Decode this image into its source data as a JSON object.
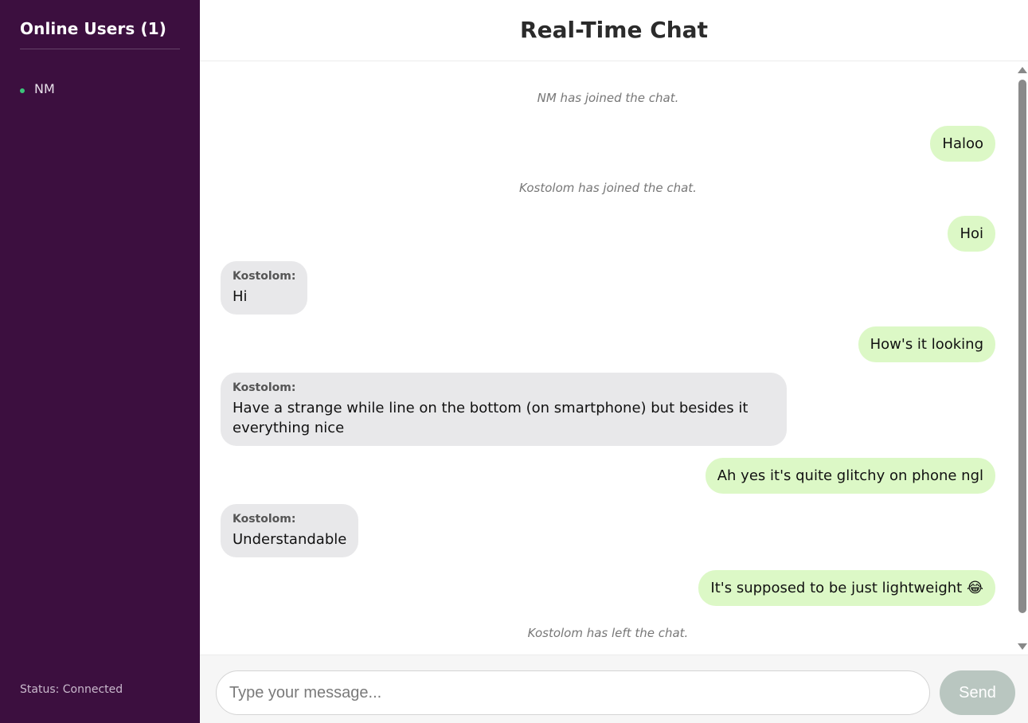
{
  "sidebar": {
    "title": "Online Users (1)",
    "users": [
      {
        "name": "NM"
      }
    ],
    "status": "Status: Connected"
  },
  "header": {
    "title": "Real-Time Chat"
  },
  "messages": [
    {
      "type": "system",
      "text": "NM has joined the chat."
    },
    {
      "type": "sent",
      "text": "Haloo"
    },
    {
      "type": "system",
      "text": "Kostolom has joined the chat."
    },
    {
      "type": "sent",
      "text": "Hoi"
    },
    {
      "type": "received",
      "sender": "Kostolom:",
      "text": "Hi"
    },
    {
      "type": "sent",
      "text": "How's it looking"
    },
    {
      "type": "received",
      "sender": "Kostolom:",
      "text": "Have a strange while line on the bottom (on smartphone) but besides it everything nice"
    },
    {
      "type": "sent",
      "text": "Ah yes it's quite glitchy on phone ngl"
    },
    {
      "type": "received",
      "sender": "Kostolom:",
      "text": "Understandable"
    },
    {
      "type": "sent",
      "text": "It's supposed to be just lightweight 😂"
    },
    {
      "type": "system",
      "text": "Kostolom has left the chat."
    }
  ],
  "composer": {
    "placeholder": "Type your message...",
    "value": "",
    "send_label": "Send"
  },
  "colors": {
    "sidebar_bg": "#3c0f3f",
    "online_dot": "#3cc47a",
    "sent_bubble": "#dcf8c6",
    "received_bubble": "#e8e8ea",
    "send_button": "#b9c6c0"
  }
}
